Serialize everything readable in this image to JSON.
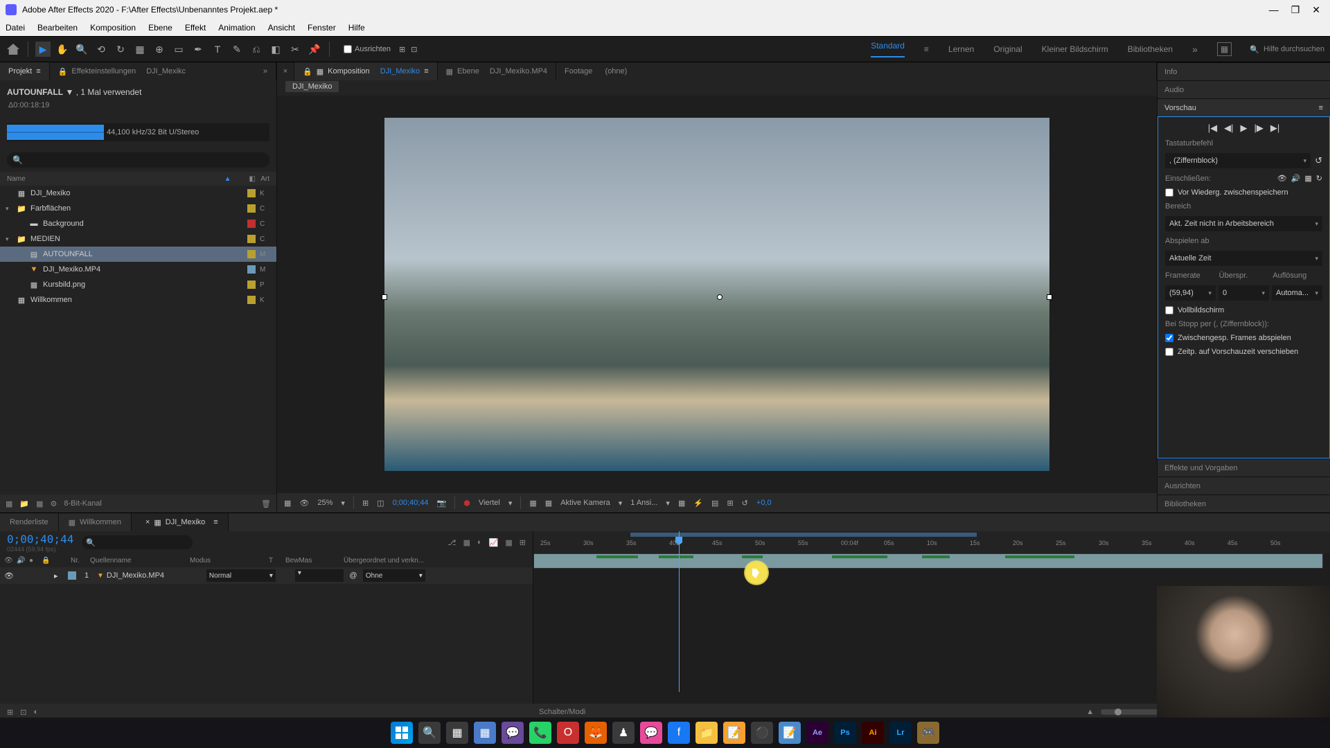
{
  "titlebar": {
    "app_name": "Adobe After Effects 2020",
    "file_path": "F:\\After Effects\\Unbenanntes Projekt.aep *"
  },
  "menus": [
    "Datei",
    "Bearbeiten",
    "Komposition",
    "Ebene",
    "Effekt",
    "Animation",
    "Ansicht",
    "Fenster",
    "Hilfe"
  ],
  "toolbar": {
    "ausrichten": "Ausrichten",
    "workspaces": [
      "Standard",
      "Lernen",
      "Original",
      "Kleiner Bildschirm",
      "Bibliotheken"
    ],
    "active_workspace": "Standard",
    "search_placeholder": "Hilfe durchsuchen"
  },
  "upper_tabs": {
    "projekt": "Projekt",
    "effekt": "Effekteinstellungen",
    "effekt_comp": "DJI_Mexikc",
    "komposition": "Komposition",
    "komp_name": "DJI_Mexiko",
    "ebene": "Ebene",
    "ebene_name": "DJI_Mexiko.MP4",
    "footage": "Footage",
    "footage_value": "(ohne)",
    "breadcrumb": "DJI_Mexiko"
  },
  "project_panel": {
    "asset_name": "AUTOUNFALL",
    "asset_used": ", 1 Mal verwendet",
    "asset_duration": "Δ0:00:18:19",
    "audio_info": "44,100 kHz/32 Bit U/Stereo",
    "columns": {
      "name": "Name",
      "art": "Art"
    },
    "items": [
      {
        "label": "DJI_Mexiko",
        "type": "K",
        "swatch": "#b8a030",
        "icon": "comp",
        "indent": 0,
        "chev": ""
      },
      {
        "label": "Farbflächen",
        "type": "C",
        "swatch": "#b8a030",
        "icon": "folder",
        "indent": 0,
        "chev": "▾"
      },
      {
        "label": "Background",
        "type": "C",
        "swatch": "#c03030",
        "icon": "solid",
        "indent": 1,
        "chev": ""
      },
      {
        "label": "MEDIEN",
        "type": "C",
        "swatch": "#b8a030",
        "icon": "folder",
        "indent": 0,
        "chev": "▾"
      },
      {
        "label": "AUTOUNFALL",
        "type": "M",
        "swatch": "#b8a030",
        "icon": "audio",
        "indent": 1,
        "chev": "",
        "selected": true
      },
      {
        "label": "DJI_Mexiko.MP4",
        "type": "M",
        "swatch": "#6a9ab8",
        "icon": "video",
        "indent": 1,
        "chev": ""
      },
      {
        "label": "Kursbild.png",
        "type": "P",
        "swatch": "#b8a030",
        "icon": "image",
        "indent": 1,
        "chev": ""
      },
      {
        "label": "Willkommen",
        "type": "K",
        "swatch": "#b8a030",
        "icon": "comp",
        "indent": 0,
        "chev": ""
      }
    ],
    "bit_depth": "8-Bit-Kanal"
  },
  "viewer": {
    "zoom": "25%",
    "timecode": "0;00;40;44",
    "resolution": "Viertel",
    "camera": "Aktive Kamera",
    "views": "1 Ansi...",
    "exposure": "+0,0"
  },
  "right": {
    "info": "Info",
    "audio": "Audio",
    "vorschau": "Vorschau",
    "tastatur_label": "Tastaturbefehl",
    "tastatur_value": ", (Ziffernblock)",
    "einschliessen": "Einschließen:",
    "vor_wiederg": "Vor Wiederg. zwischenspeichern",
    "bereich": "Bereich",
    "bereich_value": "Akt. Zeit nicht in Arbeitsbereich",
    "abspielen_ab": "Abspielen ab",
    "abspielen_value": "Aktuelle Zeit",
    "framerate": "Framerate",
    "ueberspr": "Überspr.",
    "aufloesung": "Auflösung",
    "fps_value": "(59,94)",
    "skip_value": "0",
    "res_value": "Automa...",
    "vollbild": "Vollbildschirm",
    "stopp_label": "Bei Stopp per (, (Ziffernblock)):",
    "zwischengesp": "Zwischengesp. Frames abspielen",
    "zeitp": "Zeitp. auf Vorschauzeit verschieben",
    "effekte": "Effekte und Vorgaben",
    "ausrichten": "Ausrichten",
    "bibliotheken": "Bibliotheken"
  },
  "timeline": {
    "tabs": {
      "renderliste": "Renderliste",
      "willkommen": "Willkommen",
      "dji": "DJI_Mexiko"
    },
    "timecode": "0;00;40;44",
    "sub_info": "02444 (59,94 fps)",
    "cols": {
      "nr": "Nr.",
      "quelle": "Quellenname",
      "modus": "Modus",
      "t": "T",
      "bewmas": "BewMas",
      "uebergeordnet": "Übergeordnet und verkn..."
    },
    "layer": {
      "num": "1",
      "name": "DJI_Mexiko.MP4",
      "mode": "Normal",
      "parent": "Ohne"
    },
    "ruler_ticks": [
      "25s",
      "30s",
      "35s",
      "40s",
      "45s",
      "50s",
      "55s",
      "00:04f",
      "05s",
      "10s",
      "15s",
      "20s",
      "25s",
      "30s",
      "35s",
      "40s",
      "45s",
      "50s"
    ],
    "schalter": "Schalter/Modi"
  },
  "taskbar": {
    "apps": [
      "win",
      "search",
      "tasks",
      "widgets",
      "teams",
      "whatsapp",
      "opera",
      "firefox",
      "chess",
      "messenger",
      "facebook",
      "explorer",
      "notes",
      "obs",
      "editor",
      "ae",
      "ps",
      "ai",
      "lr",
      "game"
    ]
  }
}
